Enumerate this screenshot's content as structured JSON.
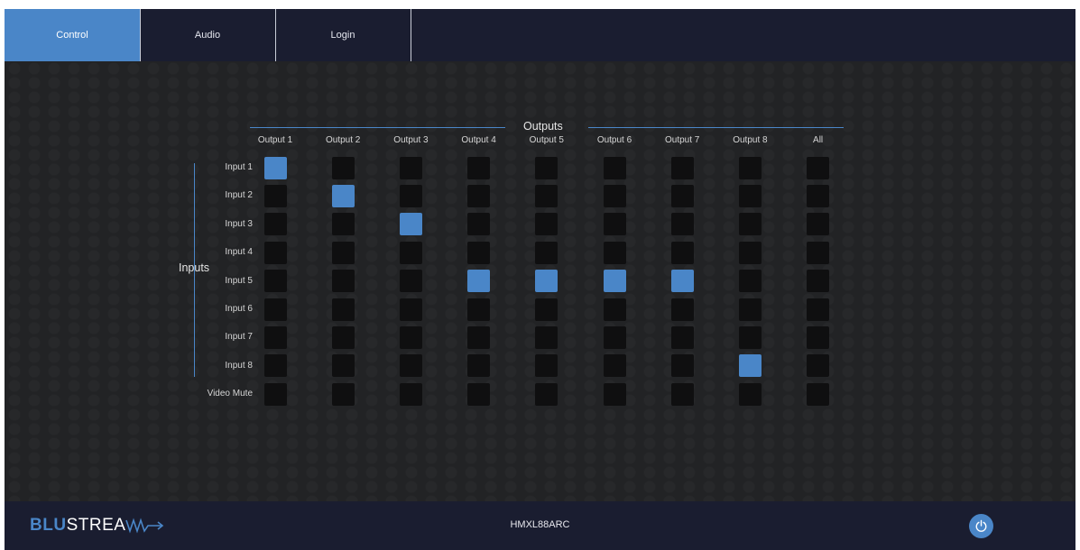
{
  "tabs": [
    {
      "label": "Control",
      "active": true
    },
    {
      "label": "Audio",
      "active": false
    },
    {
      "label": "Login",
      "active": false
    }
  ],
  "matrix": {
    "outputs_title": "Outputs",
    "inputs_title": "Inputs",
    "columns": [
      "Output 1",
      "Output 2",
      "Output 3",
      "Output 4",
      "Output 5",
      "Output 6",
      "Output 7",
      "Output 8",
      "All"
    ],
    "rows": [
      "Input 1",
      "Input 2",
      "Input 3",
      "Input 4",
      "Input 5",
      "Input 6",
      "Input 7",
      "Input 8",
      "Video Mute"
    ],
    "selected": [
      [
        true,
        false,
        false,
        false,
        false,
        false,
        false,
        false,
        false
      ],
      [
        false,
        true,
        false,
        false,
        false,
        false,
        false,
        false,
        false
      ],
      [
        false,
        false,
        true,
        false,
        false,
        false,
        false,
        false,
        false
      ],
      [
        false,
        false,
        false,
        false,
        false,
        false,
        false,
        false,
        false
      ],
      [
        false,
        false,
        false,
        true,
        true,
        true,
        true,
        false,
        false
      ],
      [
        false,
        false,
        false,
        false,
        false,
        false,
        false,
        false,
        false
      ],
      [
        false,
        false,
        false,
        false,
        false,
        false,
        false,
        false,
        false
      ],
      [
        false,
        false,
        false,
        false,
        false,
        false,
        false,
        true,
        false
      ],
      [
        false,
        false,
        false,
        false,
        false,
        false,
        false,
        false,
        false
      ]
    ]
  },
  "footer": {
    "logo_blu": "BLU",
    "logo_rest": "STREA",
    "model": "HMXL88ARC"
  },
  "colors": {
    "accent": "#4a86c8",
    "nav_bg": "#1a1d30",
    "cell_off": "#0f0f10"
  },
  "icons": {
    "power": "power-icon",
    "logo_wave": "wave-arrow-icon"
  }
}
